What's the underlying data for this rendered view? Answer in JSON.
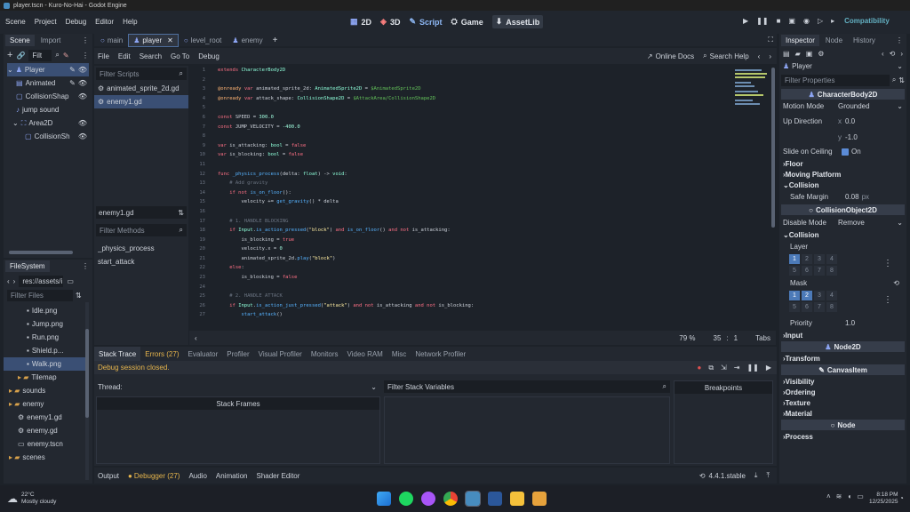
{
  "window_title": "player.tscn - Kuro-No-Hai - Godot Engine",
  "menu": [
    "Scene",
    "Project",
    "Debug",
    "Editor",
    "Help"
  ],
  "main_screens": {
    "btn_2d": "2D",
    "btn_3d": "3D",
    "btn_script": "Script",
    "btn_game": "Game",
    "btn_assetlib": "AssetLib"
  },
  "renderer": "Compatibility",
  "scene_dock": {
    "tab_scene": "Scene",
    "tab_import": "Import",
    "filter": "Filt",
    "nodes": [
      {
        "label": "Player",
        "icon": "character-body-icon"
      },
      {
        "label": "Animated",
        "icon": "animated-sprite-icon"
      },
      {
        "label": "CollisionShap",
        "icon": "collision-shape-icon"
      },
      {
        "label": "jump sound",
        "icon": "audio-icon"
      },
      {
        "label": "Area2D",
        "icon": "area2d-icon"
      },
      {
        "label": "CollisionSh",
        "icon": "collision-shape-icon"
      }
    ]
  },
  "filesystem": {
    "title": "FileSystem",
    "path": "res://assets/i",
    "filter": "Filter Files",
    "files": [
      {
        "label": "Idle.png",
        "indent": 2
      },
      {
        "label": "Jump.png",
        "indent": 2
      },
      {
        "label": "Run.png",
        "indent": 2
      },
      {
        "label": "Shield.p...",
        "indent": 2
      },
      {
        "label": "Walk.png",
        "indent": 2
      },
      {
        "label": "Tilemap",
        "indent": 1
      },
      {
        "label": "sounds",
        "indent": 0
      },
      {
        "label": "enemy",
        "indent": 0
      },
      {
        "label": "enemy1.gd",
        "indent": 1
      },
      {
        "label": "enemy.gd",
        "indent": 1
      },
      {
        "label": "enemy.tscn",
        "indent": 1
      },
      {
        "label": "scenes",
        "indent": 0
      }
    ]
  },
  "script_tabs": [
    "main",
    "player",
    "level_root",
    "enemy"
  ],
  "script_menu": [
    "File",
    "Edit",
    "Search",
    "Go To",
    "Debug"
  ],
  "online_docs": "Online Docs",
  "search_help": "Search Help",
  "filter_scripts": "Filter Scripts",
  "scripts": [
    "animated_sprite_2d.gd",
    "enemy1.gd"
  ],
  "current_script": "enemy1.gd",
  "filter_methods": "Filter Methods",
  "methods": [
    "_physics_process",
    "start_attack"
  ],
  "status": {
    "zoom": "79 %",
    "line": "35",
    "col": "1",
    "indent": "Tabs"
  },
  "code_lines": [
    {
      "n": "1",
      "html": "<span class='kw'>extends</span> <span class='ty'>CharacterBody2D</span>"
    },
    {
      "n": "2",
      "html": ""
    },
    {
      "n": "3",
      "html": "<span class='at'>@onready</span> <span class='kw'>var</span> <span class='nm'>animated_sprite_2d</span>: <span class='ty'>AnimatedSprite2D</span> = <span class='np'>$AnimatedSprite2D</span>"
    },
    {
      "n": "4",
      "html": "<span class='at'>@onready</span> <span class='kw'>var</span> <span class='nm'>attack_shape</span>: <span class='ty'>CollisionShape2D</span> = <span class='np'>$AttackArea/CollisionShape2D</span>"
    },
    {
      "n": "5",
      "html": ""
    },
    {
      "n": "6",
      "html": "<span class='kw'>const</span> <span class='nm'>SPEED</span> = <span class='num'>300.0</span>"
    },
    {
      "n": "7",
      "html": "<span class='kw'>const</span> <span class='nm'>JUMP_VELOCITY</span> = <span class='num'>-400.0</span>"
    },
    {
      "n": "8",
      "html": ""
    },
    {
      "n": "9",
      "html": "<span class='kw'>var</span> <span class='nm'>is_attacking</span>: <span class='ty'>bool</span> = <span class='kw'>false</span>"
    },
    {
      "n": "10",
      "html": "<span class='kw'>var</span> <span class='nm'>is_blocking</span>: <span class='ty'>bool</span> = <span class='kw'>false</span>"
    },
    {
      "n": "11",
      "html": ""
    },
    {
      "n": "12",
      "html": "<span class='kw'>func</span> <span class='fn'>_physics_process</span>(delta: <span class='ty'>float</span>) -> <span class='ty'>void</span>:"
    },
    {
      "n": "13",
      "html": "    <span class='cm'># Add gravity</span>"
    },
    {
      "n": "14",
      "html": "    <span class='kw'>if not</span> <span class='fn'>is_on_floor</span>():"
    },
    {
      "n": "15",
      "html": "        velocity += <span class='fn'>get_gravity</span>() * delta"
    },
    {
      "n": "16",
      "html": ""
    },
    {
      "n": "17",
      "html": "    <span class='cm'># 1. HANDLE BLOCKING</span>"
    },
    {
      "n": "18",
      "html": "    <span class='kw'>if</span> <span class='ty'>Input</span>.<span class='fn'>is_action_pressed</span>(<span class='str'>\"block\"</span>) <span class='kw'>and</span> <span class='fn'>is_on_floor</span>() <span class='kw'>and not</span> is_attacking:"
    },
    {
      "n": "19",
      "html": "        is_blocking = <span class='kw'>true</span>"
    },
    {
      "n": "20",
      "html": "        velocity.x = <span class='num'>0</span>"
    },
    {
      "n": "21",
      "html": "        animated_sprite_2d.<span class='fn'>play</span>(<span class='str'>\"block\"</span>)"
    },
    {
      "n": "22",
      "html": "    <span class='kw'>else</span>:"
    },
    {
      "n": "23",
      "html": "        is_blocking = <span class='kw'>false</span>"
    },
    {
      "n": "24",
      "html": ""
    },
    {
      "n": "25",
      "html": "    <span class='cm'># 2. HANDLE ATTACK</span>"
    },
    {
      "n": "26",
      "html": "    <span class='kw'>if</span> <span class='ty'>Input</span>.<span class='fn'>is_action_just_pressed</span>(<span class='str'>\"attack\"</span>) <span class='kw'>and not</span> is_attacking <span class='kw'>and not</span> is_blocking:"
    },
    {
      "n": "27",
      "html": "        <span class='fn'>start_attack</span>()"
    }
  ],
  "bottom_tabs": [
    "Stack Trace",
    "Errors (27)",
    "Evaluator",
    "Profiler",
    "Visual Profiler",
    "Monitors",
    "Video RAM",
    "Misc",
    "Network Profiler"
  ],
  "debug_msg": "Debug session closed.",
  "thread_label": "Thread:",
  "stack_frames": "Stack Frames",
  "filter_stack": "Filter Stack Variables",
  "breakpoints": "Breakpoints",
  "bottom_panels": [
    "Output",
    "Debugger (27)",
    "Audio",
    "Animation",
    "Shader Editor"
  ],
  "version": "4.4.1.stable",
  "inspector": {
    "tabs": [
      "Inspector",
      "Node",
      "History"
    ],
    "node": "Player",
    "filter": "Filter Properties",
    "class": "CharacterBody2D",
    "motion_mode_label": "Motion Mode",
    "motion_mode": "Grounded",
    "up_dir_label": "Up Direction",
    "up_x": "0.0",
    "up_y": "-1.0",
    "x": "x",
    "y": "y",
    "slide_label": "Slide on Ceiling",
    "slide_val": "On",
    "floor": "Floor",
    "moving_platform": "Moving Platform",
    "collision": "Collision",
    "safe_margin_label": "Safe Margin",
    "safe_margin": "0.08",
    "px": "px",
    "collision_object": "CollisionObject2D",
    "disable_mode_label": "Disable Mode",
    "disable_mode": "Remove",
    "collision2": "Collision",
    "layer": "Layer",
    "mask": "Mask",
    "priority_label": "Priority",
    "priority": "1.0",
    "input": "Input",
    "node2d": "Node2D",
    "transform": "Transform",
    "canvasitem": "CanvasItem",
    "visibility": "Visibility",
    "ordering": "Ordering",
    "texture": "Texture",
    "material": "Material",
    "node_sec": "Node",
    "process": "Process",
    "layer_nums": [
      "1",
      "2",
      "3",
      "4",
      "5",
      "6",
      "7",
      "8"
    ],
    "layer_on": [
      0
    ],
    "mask_on": [
      0,
      1
    ]
  },
  "taskbar": {
    "weather_temp": "22°C",
    "weather_desc": "Mostly cloudy",
    "time": "8:18 PM",
    "date": "12/25/2025"
  }
}
